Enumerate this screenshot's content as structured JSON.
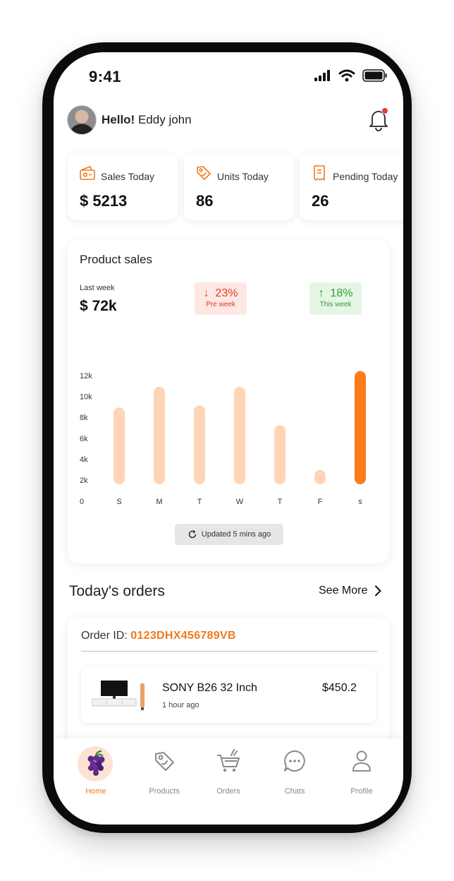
{
  "status_bar": {
    "time": "9:41"
  },
  "header": {
    "greeting_bold": "Hello!",
    "user_name": "Eddy john"
  },
  "stats": [
    {
      "label": "Sales Today",
      "value": "$ 5213",
      "icon": "wallet-icon"
    },
    {
      "label": "Units Today",
      "value": "86",
      "icon": "tag-icon"
    },
    {
      "label": "Pending Today",
      "value": "26",
      "icon": "receipt-icon"
    }
  ],
  "product_sales": {
    "title": "Product sales",
    "last_week_label": "Last week",
    "last_week_value": "$ 72k",
    "pre_week": {
      "pct": "23%",
      "label": "Pre week",
      "arrow": "↓"
    },
    "this_week": {
      "pct": "18%",
      "label": "This week",
      "arrow": "↑"
    },
    "updated_text": "Updated 5 mins ago",
    "colors": {
      "bar": "#ffd5b5",
      "highlight": "#ff7a1a"
    }
  },
  "chart_data": {
    "type": "bar",
    "categories": [
      "S",
      "M",
      "T",
      "W",
      "T",
      "F",
      "s"
    ],
    "values": [
      9000,
      11000,
      9200,
      11000,
      7300,
      3000,
      12500
    ],
    "y_tick_labels": [
      "0",
      "2k",
      "4k",
      "6k",
      "8k",
      "10k",
      "12k"
    ],
    "ylim": [
      0,
      12000
    ],
    "highlight_index": 6,
    "grid": false,
    "title": "",
    "xlabel": "",
    "ylabel": ""
  },
  "orders": {
    "title": "Today's orders",
    "see_more": "See More",
    "order_id_label": "Order ID:",
    "order_id": "0123DHX456789VB",
    "items": [
      {
        "name": "SONY B26 32 Inch",
        "time": "1 hour ago",
        "price": "$450.2"
      }
    ]
  },
  "nav": {
    "items": [
      {
        "label": "Home",
        "icon": "grapes-icon",
        "active": true
      },
      {
        "label": "Products",
        "icon": "tag-icon",
        "active": false
      },
      {
        "label": "Orders",
        "icon": "cart-icon",
        "active": false
      },
      {
        "label": "Chats",
        "icon": "chat-bubble-icon",
        "active": false
      },
      {
        "label": "Profile",
        "icon": "person-icon",
        "active": false
      }
    ],
    "colors": {
      "active": "#f07a1e",
      "inactive": "#888888"
    }
  }
}
